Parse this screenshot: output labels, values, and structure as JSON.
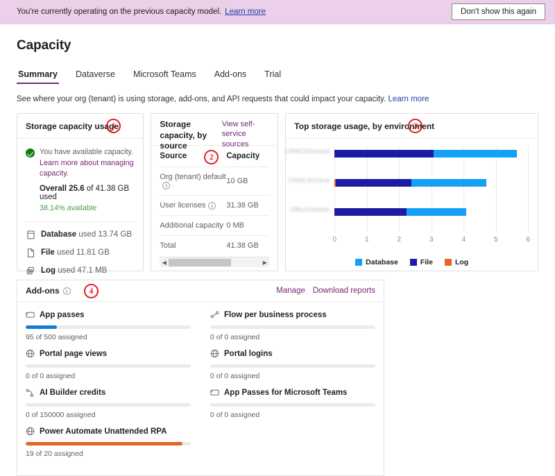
{
  "banner": {
    "text": "You're currently operating on the previous capacity model.",
    "link": "Learn more",
    "dismiss_label": "Don't show this again",
    "background": "#eccfe9"
  },
  "header": {
    "title": "Capacity",
    "subtitle": "See where your org (tenant) is using storage, add-ons, and API requests that could impact your capacity.",
    "subtitle_link": "Learn more"
  },
  "tabs": [
    {
      "label": "Summary",
      "active": true
    },
    {
      "label": "Dataverse",
      "active": false
    },
    {
      "label": "Microsoft Teams",
      "active": false
    },
    {
      "label": "Add-ons",
      "active": false
    },
    {
      "label": "Trial",
      "active": false
    }
  ],
  "markers": {
    "one": "1",
    "two": "2",
    "three": "3",
    "four": "4"
  },
  "storage_usage": {
    "title": "Storage capacity usage",
    "status_text": "You have available capacity.",
    "status_link": "Learn more about managing capacity.",
    "overall_label": "Overall",
    "overall_value": "25.6",
    "overall_of": "of 41.38 GB used",
    "percent_available": "38.14% available",
    "rows": [
      {
        "icon": "database-icon",
        "name": "Database",
        "detail": "used 13.74 GB"
      },
      {
        "icon": "file-icon",
        "name": "File",
        "detail": "used 11.81 GB"
      },
      {
        "icon": "log-icon",
        "name": "Log",
        "detail": "used 47.1 MB"
      }
    ]
  },
  "by_source": {
    "title": "Storage capacity, by source",
    "link": "View self-service sources",
    "columns": [
      "Source",
      "Capacity"
    ],
    "rows": [
      {
        "source": "Org (tenant) default",
        "info": true,
        "capacity": "10 GB"
      },
      {
        "source": "User licenses",
        "info": true,
        "capacity": "31.38 GB"
      },
      {
        "source": "Additional capacity",
        "info": false,
        "capacity": "0 MB"
      },
      {
        "source": "Total",
        "info": false,
        "capacity": "41.38 GB"
      }
    ]
  },
  "chart_data": {
    "type": "bar",
    "orientation": "horizontal",
    "stacked": true,
    "title": "Top storage usage, by environment",
    "xlabel": "",
    "ylabel": "",
    "xlim": [
      0,
      6
    ],
    "ticks": [
      0,
      1,
      2,
      3,
      4,
      5,
      6
    ],
    "tick_labels": [
      "0",
      "1",
      "2",
      "3",
      "4",
      "5",
      "6"
    ],
    "grid": true,
    "legend_position": "bottom",
    "categories": [
      "CRMC3Onlined",
      "CRMC3Online",
      "OfficeOutlook"
    ],
    "categories_redacted": true,
    "series": [
      {
        "name": "Log",
        "color": "#E8622A",
        "values": [
          0,
          0.04,
          0
        ]
      },
      {
        "name": "File",
        "color": "#1B1BA6",
        "values": [
          3.06,
          2.33,
          2.23
        ]
      },
      {
        "name": "Database",
        "color": "#12A1F5",
        "values": [
          2.59,
          2.33,
          1.84
        ]
      }
    ],
    "legend": [
      {
        "label": "Database",
        "color": "#12A1F5"
      },
      {
        "label": "File",
        "color": "#1B1BA6"
      },
      {
        "label": "Log",
        "color": "#E8622A"
      }
    ]
  },
  "addons": {
    "title": "Add-ons",
    "manage_label": "Manage",
    "download_label": "Download reports",
    "items": [
      {
        "icon": "app-passes-icon",
        "name": "App passes",
        "assigned": 95,
        "total": 500,
        "sub": "95 of 500 assigned",
        "fill_pct": 19,
        "color": "#0F7ED9"
      },
      {
        "icon": "flow-icon",
        "name": "Flow per business process",
        "assigned": 0,
        "total": 0,
        "sub": "0 of 0 assigned",
        "fill_pct": 0,
        "color": "#0F7ED9"
      },
      {
        "icon": "globe-icon",
        "name": "Portal page views",
        "assigned": 0,
        "total": 0,
        "sub": "0 of 0 assigned",
        "fill_pct": 0,
        "color": "#0F7ED9"
      },
      {
        "icon": "globe-icon",
        "name": "Portal logins",
        "assigned": 0,
        "total": 0,
        "sub": "0 of 0 assigned",
        "fill_pct": 0,
        "color": "#0F7ED9"
      },
      {
        "icon": "ai-builder-icon",
        "name": "AI Builder credits",
        "assigned": 0,
        "total": 150000,
        "sub": "0 of 150000 assigned",
        "fill_pct": 0,
        "color": "#0F7ED9"
      },
      {
        "icon": "app-passes-icon",
        "name": "App Passes for Microsoft Teams",
        "assigned": 0,
        "total": 0,
        "sub": "0 of 0 assigned",
        "fill_pct": 0,
        "color": "#0F7ED9"
      },
      {
        "icon": "globe-icon",
        "name": "Power Automate Unattended RPA",
        "assigned": 19,
        "total": 20,
        "sub": "19 of 20 assigned",
        "fill_pct": 95,
        "color": "#E8622A"
      }
    ]
  }
}
